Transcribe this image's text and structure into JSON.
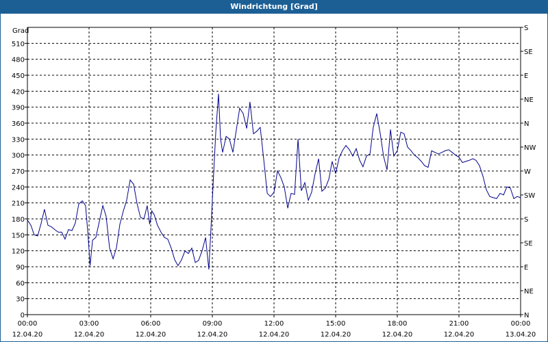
{
  "title": "Windrichtung [Grad]",
  "chart_data": {
    "type": "line",
    "ylabel": "Grad",
    "ylim": [
      0,
      540
    ],
    "yticks": [
      0,
      30,
      60,
      90,
      120,
      150,
      180,
      210,
      240,
      270,
      300,
      330,
      360,
      390,
      420,
      450,
      480,
      510
    ],
    "y2ticks": [
      {
        "value": 0,
        "label": "N"
      },
      {
        "value": 45,
        "label": "NE"
      },
      {
        "value": 90,
        "label": "E"
      },
      {
        "value": 135,
        "label": "SE"
      },
      {
        "value": 180,
        "label": "S"
      },
      {
        "value": 225,
        "label": "SW"
      },
      {
        "value": 270,
        "label": "W"
      },
      {
        "value": 315,
        "label": "NW"
      },
      {
        "value": 360,
        "label": "N"
      },
      {
        "value": 405,
        "label": "NE"
      },
      {
        "value": 450,
        "label": "E"
      },
      {
        "value": 495,
        "label": "SE"
      },
      {
        "value": 540,
        "label": "S"
      }
    ],
    "xlim": [
      0,
      24
    ],
    "xticks": [
      {
        "hour": 0,
        "time": "00:00",
        "date": "12.04.20"
      },
      {
        "hour": 3,
        "time": "03:00",
        "date": "12.04.20"
      },
      {
        "hour": 6,
        "time": "06:00",
        "date": "12.04.20"
      },
      {
        "hour": 9,
        "time": "09:00",
        "date": "12.04.20"
      },
      {
        "hour": 12,
        "time": "12:00",
        "date": "12.04.20"
      },
      {
        "hour": 15,
        "time": "15:00",
        "date": "12.04.20"
      },
      {
        "hour": 18,
        "time": "18:00",
        "date": "12.04.20"
      },
      {
        "hour": 21,
        "time": "21:00",
        "date": "12.04.20"
      },
      {
        "hour": 24,
        "time": "00:00",
        "date": "13.04.20"
      }
    ],
    "grid": true,
    "line_color": "#00008b",
    "series": [
      {
        "x": [
          0,
          0.17,
          0.33,
          0.5,
          0.67,
          0.83,
          1.0,
          1.17,
          1.33,
          1.5,
          1.67,
          1.83,
          2.0,
          2.17,
          2.33,
          2.5,
          2.67,
          2.83,
          2.95,
          3.05,
          3.17,
          3.33,
          3.5,
          3.67,
          3.83,
          4.0,
          4.17,
          4.33,
          4.5,
          4.67,
          4.83,
          5.0,
          5.17,
          5.33,
          5.5,
          5.67,
          5.83,
          5.95,
          6.05,
          6.17,
          6.33,
          6.5,
          6.67,
          6.83,
          7.0,
          7.17,
          7.33,
          7.5,
          7.67,
          7.83,
          8.0,
          8.17,
          8.33,
          8.5,
          8.67,
          8.83,
          8.95,
          9.05,
          9.17,
          9.3,
          9.4,
          9.5,
          9.67,
          9.83,
          10.0,
          10.17,
          10.33,
          10.5,
          10.67,
          10.83,
          11.0,
          11.17,
          11.33,
          11.5,
          11.67,
          11.83,
          12.0,
          12.17,
          12.33,
          12.5,
          12.67,
          12.83,
          13.0,
          13.17,
          13.33,
          13.5,
          13.67,
          13.83,
          14.0,
          14.17,
          14.33,
          14.5,
          14.67,
          14.83,
          15.0,
          15.17,
          15.33,
          15.5,
          15.67,
          15.83,
          16.0,
          16.17,
          16.33,
          16.5,
          16.67,
          16.83,
          17.0,
          17.17,
          17.33,
          17.5,
          17.67,
          17.83,
          18.0,
          18.17,
          18.33,
          18.5,
          18.67,
          18.83,
          19.0,
          19.17,
          19.33,
          19.5,
          19.67,
          19.83,
          20.0,
          20.17,
          20.33,
          20.5,
          20.67,
          20.83,
          21.0,
          21.17,
          21.33,
          21.5,
          21.67,
          21.83,
          22.0,
          22.17,
          22.33,
          22.5,
          22.67,
          22.83,
          23.0,
          23.17,
          23.33,
          23.5,
          23.67,
          23.83,
          24.0
        ],
        "y": [
          178,
          168,
          150,
          148,
          172,
          198,
          168,
          165,
          160,
          155,
          155,
          142,
          160,
          158,
          172,
          208,
          214,
          205,
          150,
          92,
          140,
          145,
          175,
          205,
          185,
          125,
          105,
          125,
          170,
          195,
          215,
          253,
          245,
          210,
          183,
          180,
          205,
          170,
          195,
          188,
          168,
          155,
          145,
          142,
          125,
          103,
          92,
          103,
          120,
          115,
          125,
          98,
          102,
          120,
          145,
          85,
          175,
          255,
          345,
          415,
          330,
          305,
          335,
          330,
          305,
          348,
          388,
          378,
          350,
          400,
          340,
          345,
          352,
          292,
          228,
          222,
          230,
          270,
          258,
          240,
          200,
          228,
          226,
          330,
          233,
          248,
          215,
          230,
          265,
          293,
          232,
          238,
          255,
          288,
          265,
          295,
          308,
          318,
          310,
          298,
          312,
          290,
          278,
          298,
          302,
          352,
          378,
          340,
          298,
          272,
          348,
          298,
          308,
          343,
          340,
          315,
          308,
          300,
          295,
          288,
          280,
          277,
          308,
          305,
          302,
          305,
          308,
          310,
          305,
          300,
          296,
          286,
          288,
          290,
          293,
          290,
          280,
          260,
          235,
          222,
          220,
          218,
          228,
          225,
          240,
          238,
          218,
          222,
          220
        ]
      }
    ]
  }
}
